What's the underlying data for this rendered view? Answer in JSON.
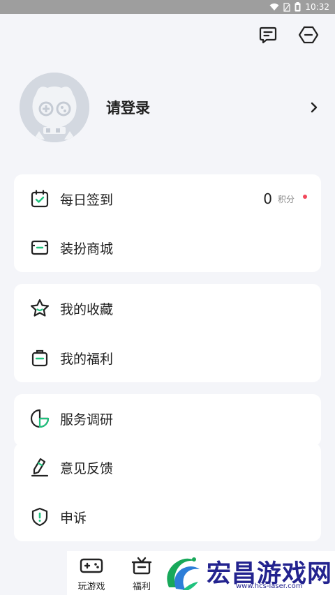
{
  "status_bar": {
    "time": "10:32"
  },
  "profile": {
    "login_prompt": "请登录"
  },
  "menu": {
    "checkin": {
      "label": "每日签到",
      "points_value": "0",
      "points_unit": "积分"
    },
    "dress_shop": {
      "label": "装扮商城"
    },
    "favorites": {
      "label": "我的收藏"
    },
    "welfare": {
      "label": "我的福利"
    },
    "survey": {
      "label": "服务调研"
    },
    "feedback": {
      "label": "意见反馈"
    },
    "appeal": {
      "label": "申诉"
    }
  },
  "bottom_nav": {
    "items": [
      {
        "label": "玩游戏",
        "icon": "gamepad-icon"
      },
      {
        "label": "福利",
        "icon": "gift-icon"
      }
    ]
  },
  "watermark": {
    "text": "宏昌游戏网",
    "url": "www.hcs-laser.com"
  },
  "colors": {
    "accent": "#1fc27e",
    "background": "#f4f5f9",
    "badge": "#f2475a",
    "watermark": "#23238f"
  }
}
